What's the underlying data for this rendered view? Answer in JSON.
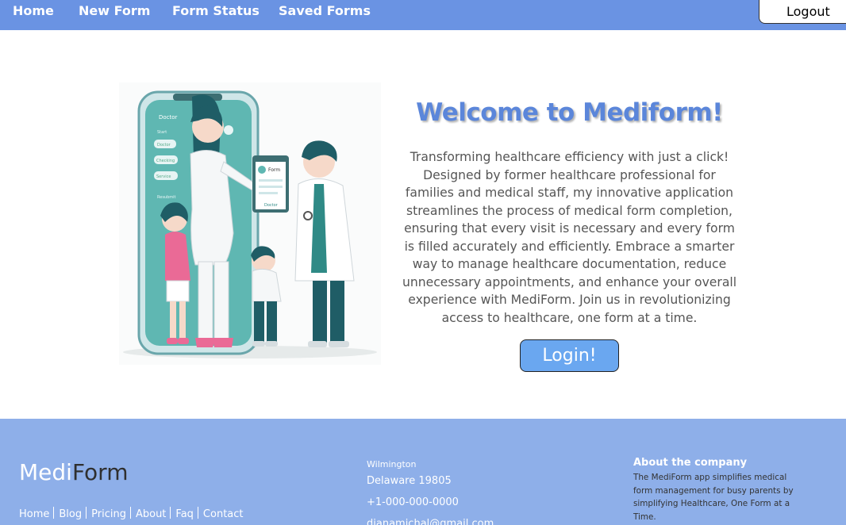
{
  "nav": {
    "links": [
      "Home",
      "New Form",
      "Form Status",
      "Saved Forms"
    ],
    "logout_label": "Logout"
  },
  "hero": {
    "title": "Welcome to Mediform!",
    "intro": "Transforming healthcare efficiency with just a click! Designed by former healthcare professional for families and medical staff, my innovative application streamlines the process of medical form completion, ensuring that every visit is necessary and every form is filled accurately and efficiently. Embrace a smarter way to manage healthcare documentation, reduce unnecessary appointments, and enhance your overall experience with MediForm. Join us in revolutionizing access to healthcare, one form at a time.",
    "login_label": "Login!",
    "phone_screen": {
      "header": "Doctor",
      "items": [
        "Start",
        "Doctor",
        "Checking",
        "Service",
        "Resubmit"
      ]
    },
    "clipboard": {
      "title": "Form",
      "footer": "Doctor"
    }
  },
  "footer": {
    "brand_part1": "Medi",
    "brand_part2": "Form",
    "links": [
      "Home",
      "Blog",
      "Pricing",
      "About",
      "Faq",
      "Contact"
    ],
    "city": "Wilmington",
    "state": "Delaware 19805",
    "phone": "+1-000-000-0000",
    "email": "dianamichal@gmail.com",
    "about_heading": "About the company",
    "about_text": "The MediForm app simplifies medical form management for busy parents by simplifying Healthcare, One Form at a Time."
  },
  "colors": {
    "nav_bg": "#6a93e3",
    "title": "#5b86da",
    "login_bg": "#6aa7f0",
    "footer_bg": "#8eafe9",
    "teal": "#5fb7b2"
  }
}
